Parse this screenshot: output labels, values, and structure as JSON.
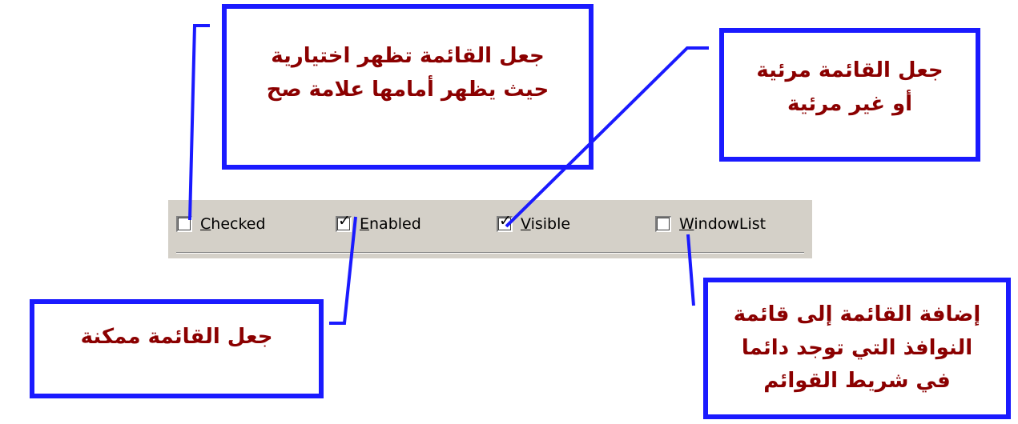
{
  "callouts": {
    "checked": {
      "line1": "جعل القائمة تظهر اختيارية",
      "line2": "حيث يظهر أمامها علامة صح"
    },
    "visible": {
      "line1": "جعل القائمة مرئية",
      "line2": "أو غير مرئية"
    },
    "enabled": {
      "line1": "جعل القائمة ممكنة"
    },
    "windowlist": {
      "line1": "إضافة القائمة إلى قائمة",
      "line2": "النوافذ التي توجد دائما",
      "line3": "في شريط القوائم"
    }
  },
  "options": [
    {
      "key": "C",
      "rest": "hecked",
      "checked": false
    },
    {
      "key": "E",
      "rest": "nabled",
      "checked": true
    },
    {
      "key": "V",
      "rest": "isible",
      "checked": true
    },
    {
      "key": "W",
      "rest": "indowList",
      "checked": false
    }
  ],
  "check_mark": "✓",
  "colors": {
    "callout_border": "#1a1aff",
    "callout_text": "#8b0000",
    "toolbar_bg": "#d4d0c8",
    "leader_line": "#1a1aff"
  }
}
